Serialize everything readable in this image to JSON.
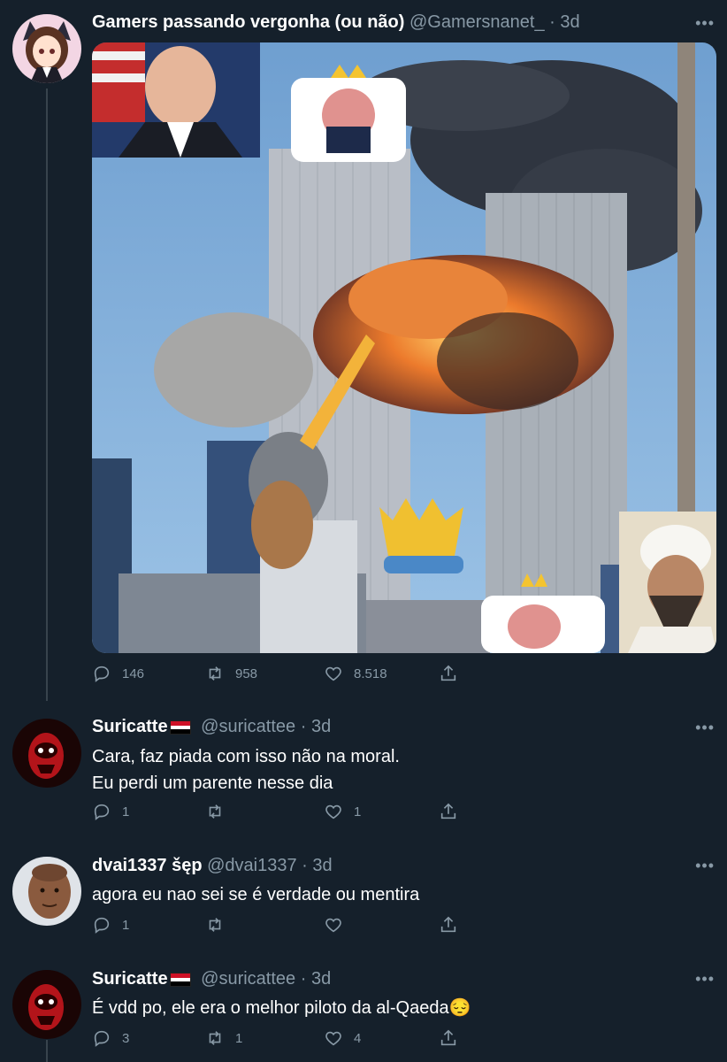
{
  "tweets": [
    {
      "name": "Gamers passando vergonha (ou não)",
      "handle": "@Gamersnanet_",
      "time": "3d",
      "lines": [],
      "replies": "146",
      "retweets": "958",
      "likes": "8.518"
    },
    {
      "name": "Suricatte",
      "flag": "yemen-flag",
      "handle": "@suricattee",
      "time": "3d",
      "lines": [
        "Cara, faz piada com isso não na moral.",
        "Eu perdi um parente nesse dia"
      ],
      "replies": "1",
      "retweets": "",
      "likes": "1"
    },
    {
      "name": "dvai1337 šęp",
      "handle": "@dvai1337",
      "time": "3d",
      "lines": [
        "agora eu nao sei se é verdade ou mentira"
      ],
      "replies": "1",
      "retweets": "",
      "likes": ""
    },
    {
      "name": "Suricatte",
      "flag": "yemen-flag",
      "handle": "@suricattee",
      "time": "3d",
      "lines": [
        "É vdd po, ele era o melhor piloto da al-Qaeda😔"
      ],
      "replies": "3",
      "retweets": "1",
      "likes": "4"
    }
  ],
  "separator": " · ",
  "more_label": "•••",
  "colors": {
    "background": "#15202b",
    "secondary_text": "#8899a6",
    "thread_line": "#38444d"
  }
}
